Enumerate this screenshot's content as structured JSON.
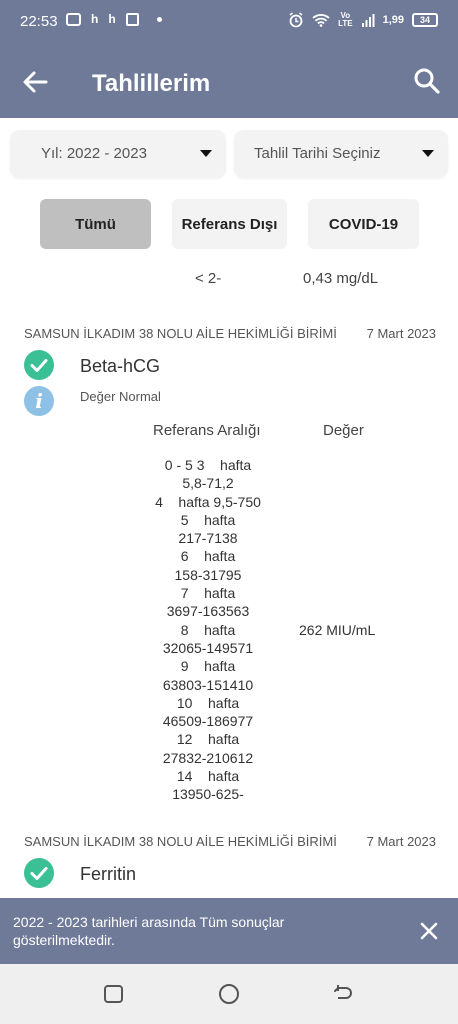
{
  "status_bar": {
    "time": "22:53",
    "notif_letter_1": "h",
    "notif_letter_2": "h",
    "lte_label": "Vo\nLTE",
    "speed": "1,99",
    "battery": "34"
  },
  "app_bar": {
    "title": "Tahlillerim",
    "back_icon": "arrow-left-icon",
    "search_icon": "search-icon"
  },
  "filters": {
    "year_select": "Yıl: 2022 - 2023",
    "date_select": "Tahlil Tarihi Seçiniz"
  },
  "tabs": [
    {
      "label": "Tümü",
      "active": true
    },
    {
      "label": "Referans Dışı",
      "active": false
    },
    {
      "label": "COVID-19",
      "active": false
    }
  ],
  "previous_row": {
    "reference": "< 2-",
    "value": "0,43 mg/dL"
  },
  "records": [
    {
      "institution": "SAMSUN İLKADIM 38 NOLU AİLE HEKİMLİĞİ BİRİMİ",
      "date": "7 Mart 2023",
      "test_name": "Beta-hCG",
      "status": "Değer Normal",
      "reference_header": "Referans Aralığı",
      "value_header": "Değer",
      "reference_lines": [
        "0 - 5 3    hafta",
        "5,8-71,2",
        "4    hafta 9,5-750",
        "5    hafta",
        "217-7138",
        "6    hafta",
        "158-31795",
        "7    hafta",
        "3697-163563",
        "8    hafta",
        "32065-149571",
        "9    hafta",
        "63803-151410",
        "10    hafta",
        "46509-186977",
        "12    hafta",
        "27832-210612",
        "14    hafta",
        "13950-625-"
      ],
      "value": "262 MIU/mL"
    },
    {
      "institution": "SAMSUN İLKADIM 38 NOLU AİLE HEKİMLİĞİ BİRİMİ",
      "date": "7 Mart 2023",
      "test_name": "Ferritin"
    }
  ],
  "snackbar": {
    "message": "2022 - 2023 tarihleri arasında Tüm sonuçlar gösterilmektedir.",
    "close_icon": "close-icon"
  },
  "colors": {
    "primary": "#6f7a99",
    "check": "#3bbf95",
    "info": "#8fc1e6",
    "tab_active": "#bfbfbf"
  }
}
